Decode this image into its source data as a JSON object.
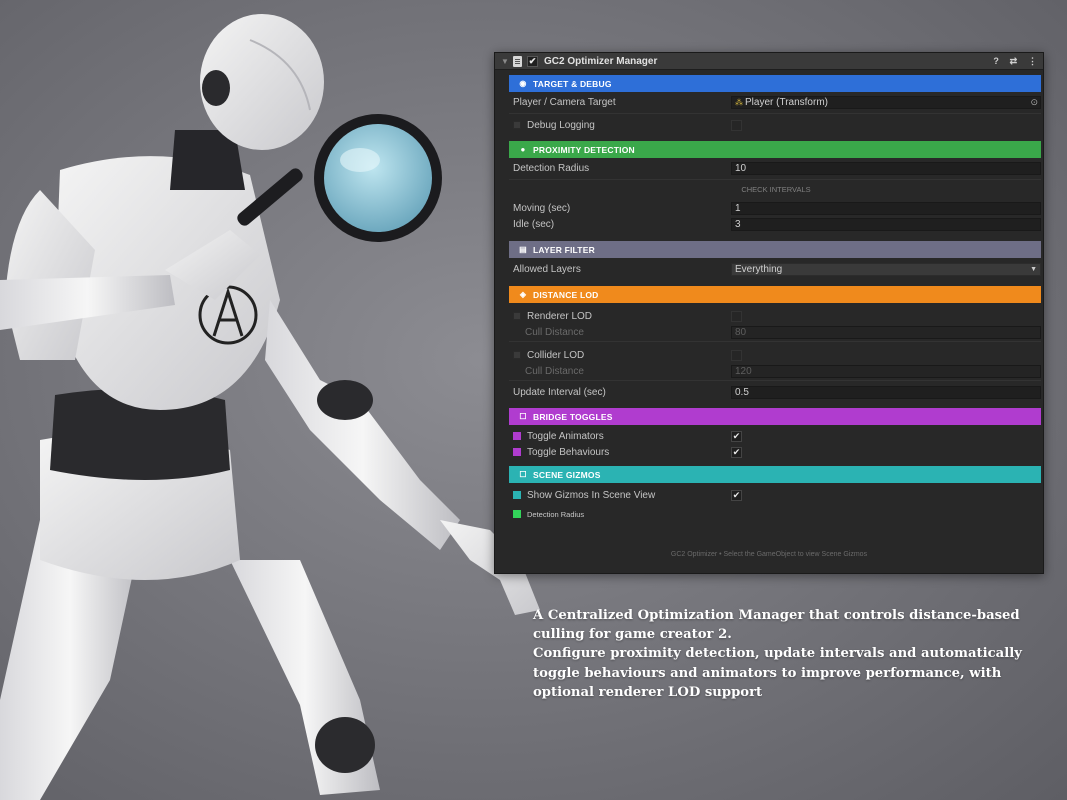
{
  "component": {
    "title": "GC2 Optimizer Manager",
    "icons": [
      "fold-arrow-icon",
      "script-icon",
      "help-icon",
      "preset-icon",
      "kebab-menu-icon"
    ],
    "enabled": true
  },
  "sections": {
    "target_debug": {
      "title": "TARGET & DEBUG",
      "color": "#2e6fd8",
      "player_label": "Player / Camera Target",
      "player_value": "Player (Transform)",
      "debug_label": "Debug Logging",
      "debug_checked": false
    },
    "proximity": {
      "title": "PROXIMITY DETECTION",
      "color": "#3aa84a",
      "radius_label": "Detection Radius",
      "radius_value": "10",
      "intervals_caption": "CHECK INTERVALS",
      "moving_label": "Moving  (sec)",
      "moving_value": "1",
      "idle_label": "Idle  (sec)",
      "idle_value": "3"
    },
    "layer_filter": {
      "title": "LAYER FILTER",
      "color": "#6e6e86",
      "allowed_label": "Allowed Layers",
      "allowed_value": "Everything"
    },
    "distance_lod": {
      "title": "DISTANCE LOD",
      "color": "#f08a1c",
      "renderer_label": "Renderer LOD",
      "renderer_cull_label": "Cull Distance",
      "renderer_cull_value": "80",
      "collider_label": "Collider LOD",
      "collider_cull_label": "Cull Distance",
      "collider_cull_value": "120",
      "update_label": "Update Interval  (sec)",
      "update_value": "0.5"
    },
    "bridge_toggles": {
      "title": "BRIDGE TOGGLES",
      "color": "#b03ccf",
      "animators_label": "Toggle Animators",
      "animators_checked": true,
      "behaviours_label": "Toggle Behaviours",
      "behaviours_checked": true
    },
    "scene_gizmos": {
      "title": "SCENE GIZMOS",
      "color": "#2bb3b3",
      "show_label": "Show Gizmos In Scene View",
      "show_checked": true,
      "radius_legend": "Detection Radius",
      "radius_legend_color": "#33d45a"
    }
  },
  "footer": "GC2 Optimizer  •  Select the GameObject to view Scene Gizmos",
  "caption": {
    "line1": "A Centralized Optimization Manager that controls distance-based\nculling for game creator 2.",
    "line2": "Configure proximity detection, update intervals and automatically\ntoggle behaviours and animators to improve performance, with\noptional renderer LOD support"
  }
}
